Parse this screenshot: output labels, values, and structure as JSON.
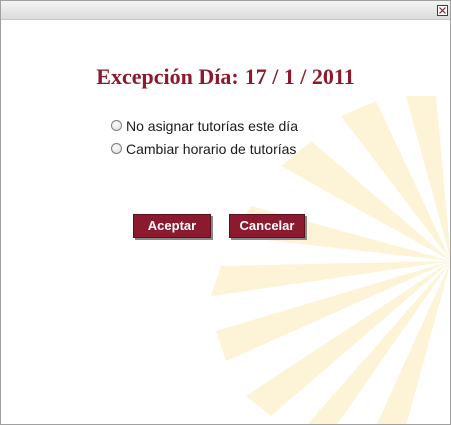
{
  "window": {
    "close_icon": "close-icon"
  },
  "dialog": {
    "title_prefix": "Excepción Día:",
    "date": "17 / 1 / 2011"
  },
  "options": [
    {
      "label": "No asignar tutorías este día",
      "selected": false
    },
    {
      "label": "Cambiar horario de tutorías",
      "selected": false
    }
  ],
  "buttons": {
    "accept": "Aceptar",
    "cancel": "Cancelar"
  },
  "colors": {
    "accent": "#8b1a2e",
    "watermark": "#fdf3d6"
  }
}
